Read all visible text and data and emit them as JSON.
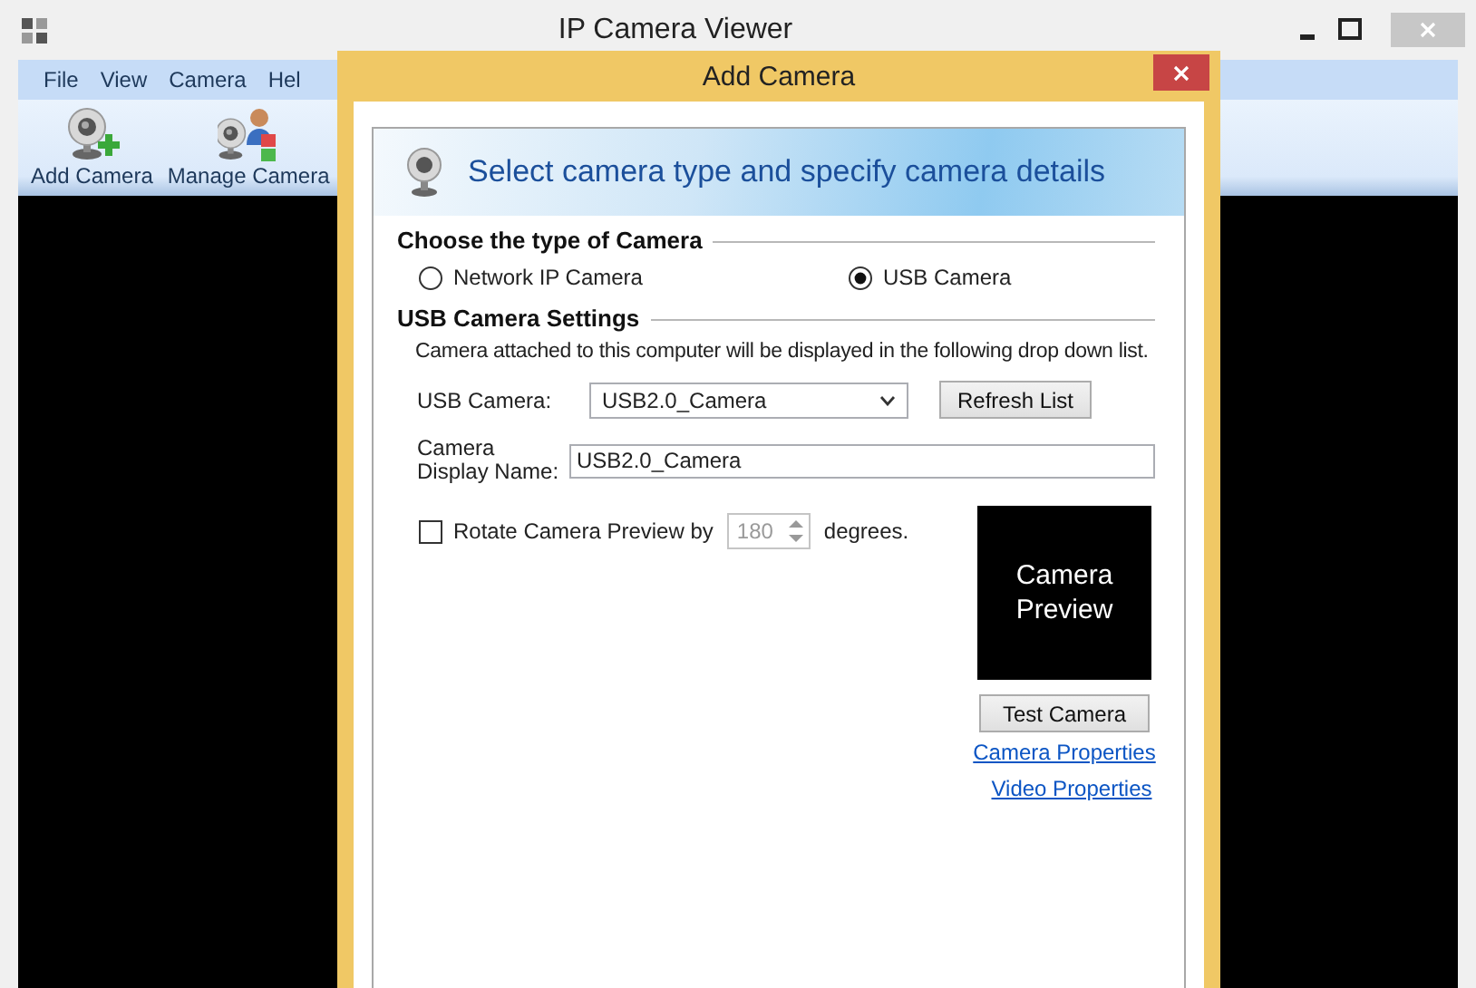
{
  "window": {
    "title": "IP Camera Viewer"
  },
  "menu": [
    {
      "label": "File"
    },
    {
      "label": "View"
    },
    {
      "label": "Camera"
    },
    {
      "label": "Hel"
    }
  ],
  "toolbar": [
    {
      "label": "Add Camera",
      "kind": "add"
    },
    {
      "label": "Manage Camera",
      "kind": "manage"
    }
  ],
  "dialog": {
    "title": "Add Camera",
    "header": "Select camera type and specify camera details",
    "camera_type": {
      "heading": "Choose the type of Camera",
      "options": [
        {
          "label": "Network IP Camera",
          "selected": false
        },
        {
          "label": "USB Camera",
          "selected": true
        }
      ]
    },
    "usb_settings": {
      "heading": "USB Camera Settings",
      "description": "Camera attached to this computer will be displayed in the following drop down list.",
      "usb_camera": {
        "label": "USB Camera:",
        "value": "USB2.0_Camera"
      },
      "refresh_button": "Refresh List",
      "display_name": {
        "label": "Camera Display Name:",
        "value": "USB2.0_Camera"
      },
      "rotate": {
        "label": "Rotate Camera Preview by",
        "checked": false,
        "value": "180",
        "disabled": true,
        "unit": "degrees."
      },
      "preview": {
        "text": "Camera Preview"
      },
      "test_button": "Test Camera",
      "links": [
        "Camera Properties",
        "Video Properties"
      ]
    }
  }
}
